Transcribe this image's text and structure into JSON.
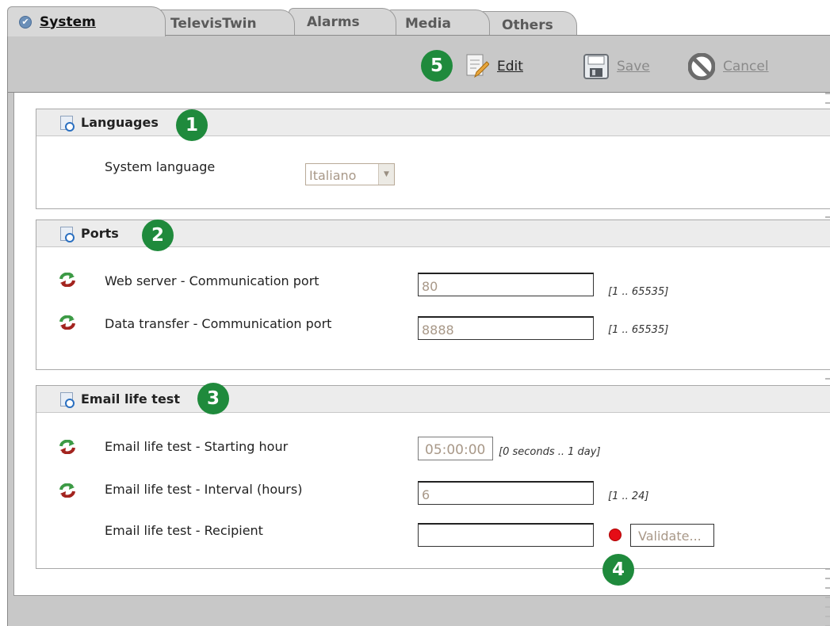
{
  "tabs": [
    {
      "label": "System",
      "active": true
    },
    {
      "label": "TelevisTwin",
      "active": false
    },
    {
      "label": "Alarms",
      "active": false
    },
    {
      "label": "Media",
      "active": false
    },
    {
      "label": "Others",
      "active": false
    }
  ],
  "toolbar": {
    "edit_label": "Edit",
    "save_label": "Save",
    "cancel_label": "Cancel"
  },
  "markers": {
    "m1": "1",
    "m2": "2",
    "m3": "3",
    "m4": "4",
    "m5": "5"
  },
  "languages": {
    "title": "Languages",
    "system_language_label": "System language",
    "system_language_value": "Italiano"
  },
  "ports": {
    "title": "Ports",
    "web_label": "Web server - Communication port",
    "web_value": "80",
    "web_range": "[1 .. 65535]",
    "data_label": "Data transfer - Communication port",
    "data_value": "8888",
    "data_range": "[1 .. 65535]"
  },
  "email": {
    "title": "Email life test",
    "start_label": "Email life test - Starting hour",
    "start_value": "05:00:00",
    "start_range": "[0 seconds .. 1 day]",
    "interval_label": "Email life test - Interval (hours)",
    "interval_value": "6",
    "interval_range": "[1 .. 24]",
    "recipient_label": "Email life test - Recipient",
    "recipient_value": "",
    "validate_label": "Validate..."
  },
  "colors": {
    "marker": "#1f8a3c",
    "status_dot": "#e50d16",
    "accent_check": "#6b8fb8"
  }
}
